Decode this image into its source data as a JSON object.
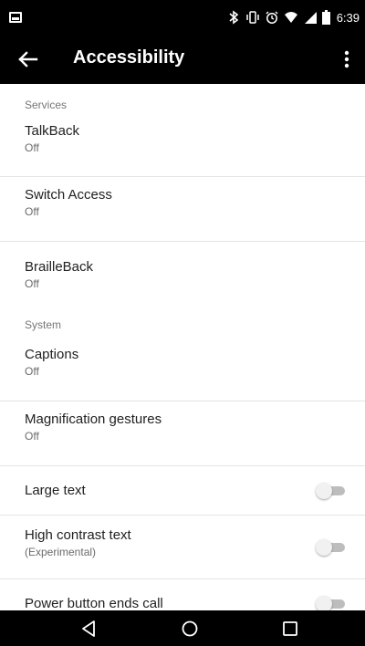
{
  "status_bar": {
    "time": "6:39",
    "icons": [
      "notification-icon",
      "bluetooth-icon",
      "vibrate-icon",
      "alarm-icon",
      "wifi-icon",
      "signal-icon",
      "battery-icon"
    ]
  },
  "app_bar": {
    "title": "Accessibility",
    "back_icon": "arrow-back-icon",
    "overflow_icon": "more-vert-icon"
  },
  "sections": {
    "services": {
      "header": "Services",
      "items": [
        {
          "title": "TalkBack",
          "subtitle": "Off"
        },
        {
          "title": "Switch Access",
          "subtitle": "Off"
        },
        {
          "title": "BrailleBack",
          "subtitle": "Off"
        }
      ]
    },
    "system": {
      "header": "System",
      "items": [
        {
          "title": "Captions",
          "subtitle": "Off"
        },
        {
          "title": "Magnification gestures",
          "subtitle": "Off"
        },
        {
          "title": "Large text",
          "toggle": false
        },
        {
          "title": "High contrast text",
          "subtitle": "(Experimental)",
          "toggle": false
        },
        {
          "title": "Power button ends call",
          "toggle": false
        }
      ]
    }
  },
  "nav_bar": {
    "icons": [
      "back-triangle-icon",
      "home-circle-icon",
      "recents-square-icon"
    ]
  },
  "colors": {
    "bar_background": "#000000",
    "content_background": "#ffffff",
    "section_header": "#757575",
    "toggle_track_off": "#bdbdbd"
  }
}
